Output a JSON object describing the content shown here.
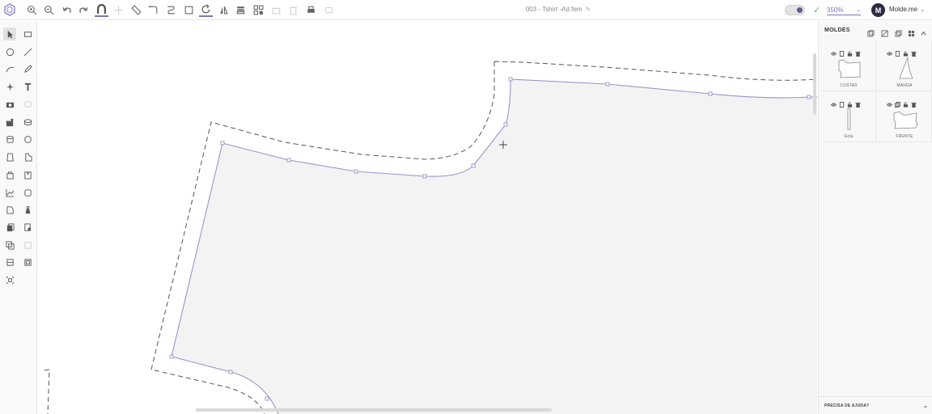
{
  "header": {
    "document_title": "003 - Tshirt -Ad fem",
    "zoom_value": "350%",
    "user_initial": "M",
    "user_name": "Molde.me"
  },
  "toolbar": {
    "tools": [
      {
        "icon": "zoom-in-icon"
      },
      {
        "icon": "zoom-out-icon"
      },
      {
        "icon": "undo-icon"
      },
      {
        "icon": "redo-icon"
      },
      {
        "icon": "magnet-icon",
        "active": true
      },
      {
        "icon": "cross-guide-icon"
      },
      {
        "icon": "ruler-icon"
      },
      {
        "icon": "path-icon"
      },
      {
        "icon": "curve-path-icon"
      },
      {
        "icon": "square-icon"
      },
      {
        "icon": "rotate-icon",
        "active": true
      },
      {
        "icon": "mirror-icon"
      },
      {
        "icon": "layers-icon"
      },
      {
        "icon": "arrange-icon"
      },
      {
        "icon": "disabled-tool-icon"
      },
      {
        "icon": "trash-icon"
      },
      {
        "icon": "print-icon"
      },
      {
        "icon": "disabled-tool-icon"
      }
    ]
  },
  "side_panel": {
    "title": "MOLDES",
    "pieces": [
      {
        "name": "COSTAS"
      },
      {
        "name": "MANGA"
      },
      {
        "name": "Gola"
      },
      {
        "name": "FRENTE"
      }
    ],
    "help_label": "PRECISA DE AJUDA?"
  }
}
